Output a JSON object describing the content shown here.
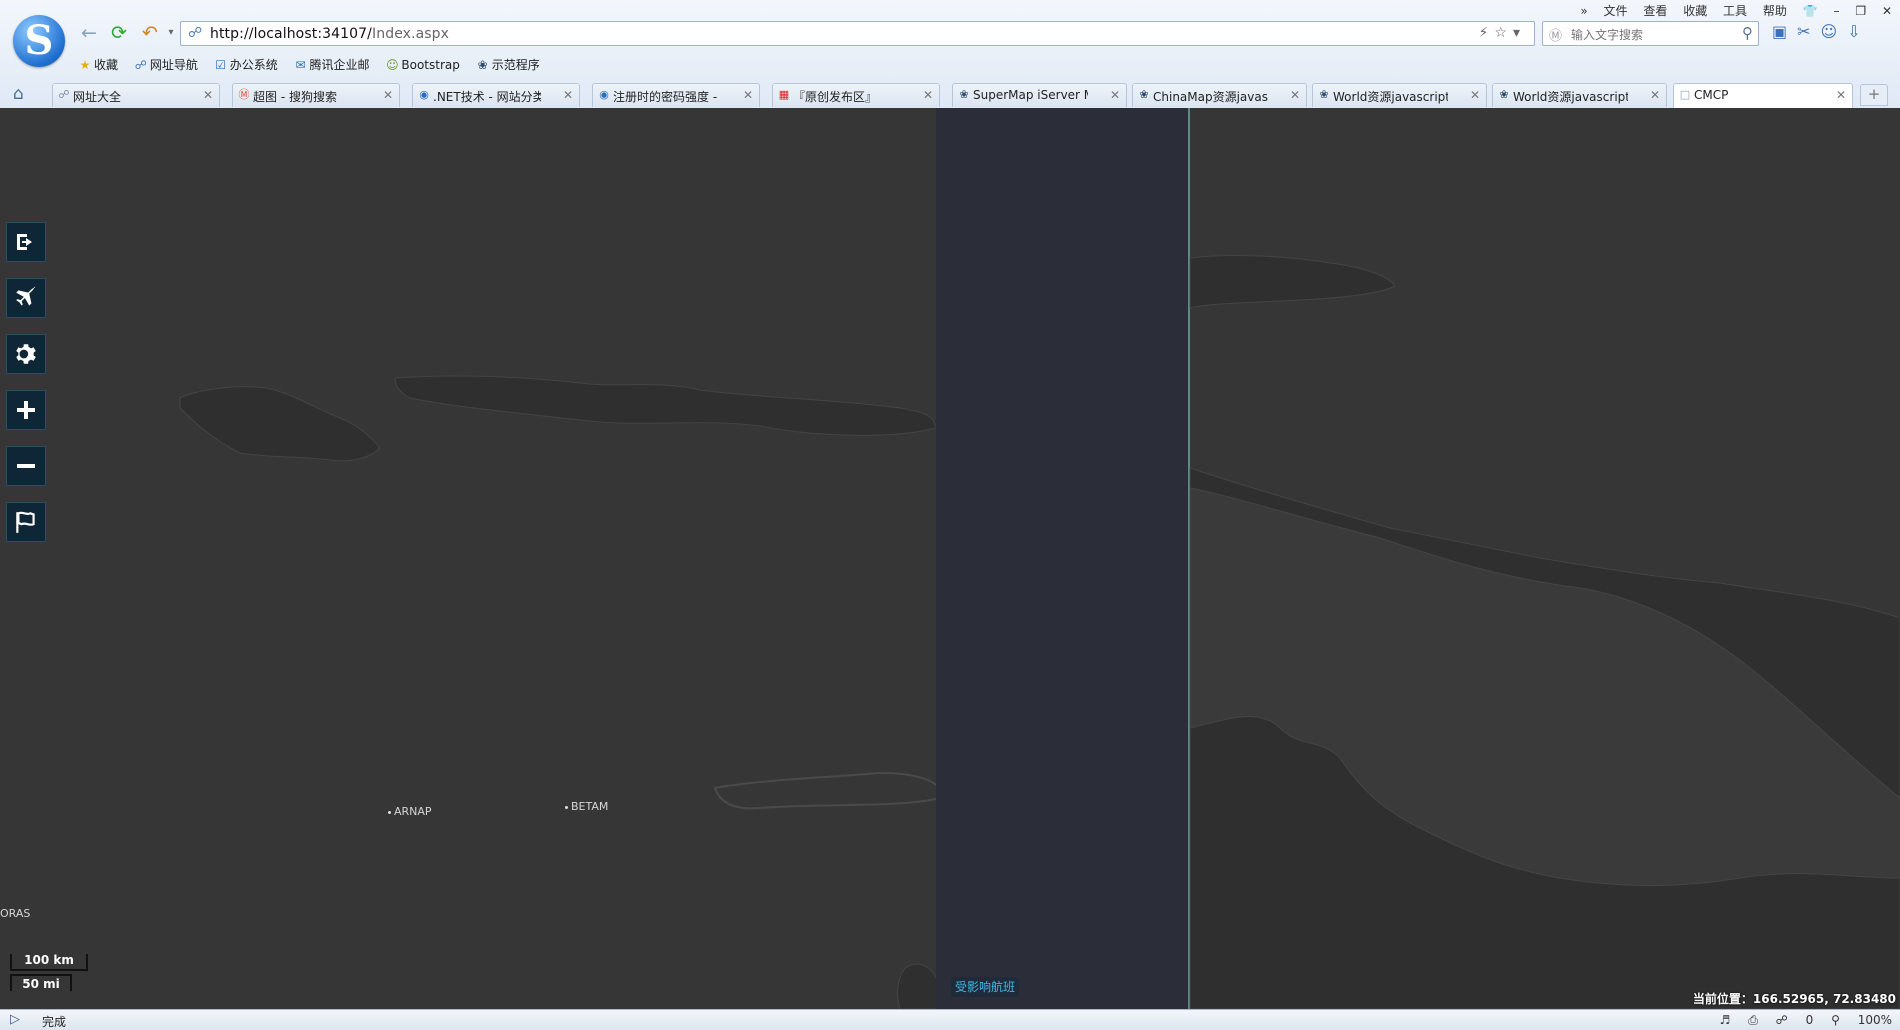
{
  "browser": {
    "url_host": "http://localhost:34107/",
    "url_path": "Index.aspx",
    "search_placeholder": "输入文字搜索",
    "menu": [
      "文件",
      "查看",
      "收藏",
      "工具",
      "帮助"
    ],
    "bookmarks": [
      {
        "label": "收藏",
        "icon": "star-icon"
      },
      {
        "label": "网址导航",
        "icon": "globe-icon"
      },
      {
        "label": "办公系统",
        "icon": "check-icon"
      },
      {
        "label": "腾讯企业邮",
        "icon": "mail-icon"
      },
      {
        "label": "Bootstrap",
        "icon": "bootstrap-icon"
      },
      {
        "label": "示范程序",
        "icon": "supermap-icon"
      }
    ],
    "tabs": [
      {
        "label": "网址大全"
      },
      {
        "label": "超图 - 搜狗搜索"
      },
      {
        "label": ".NET技术 - 网站分类 -"
      },
      {
        "label": "注册时的密码强度 - gir"
      },
      {
        "label": "『原创发布区』"
      },
      {
        "label": "SuperMap iServer Ma"
      },
      {
        "label": "ChinaMap资源javascri"
      },
      {
        "label": "World资源javascript示"
      },
      {
        "label": "World资源javascript示"
      },
      {
        "label": "CMCP"
      }
    ],
    "status_text": "完成",
    "status_right": [
      "0",
      "100%"
    ]
  },
  "map": {
    "labels": [
      "ARNAP",
      "BETAM",
      "ORAS"
    ],
    "scale_km": "100 km",
    "scale_mi": "50 mi",
    "flight_button": "受影响航班",
    "coord_label": "当前位置：",
    "coord_value": "166.52965, 72.83480",
    "controls": [
      "exit-icon",
      "plane-icon",
      "gear-icon",
      "plus-icon",
      "minus-icon",
      "flag-icon"
    ],
    "colors": {
      "land": "#3a3a3a",
      "water": "#2f2f2f",
      "panel": "#2b2e38",
      "border_line": "#6aa9a2",
      "control_bg": "#0f2636",
      "flight_text": "#3fb8e0"
    }
  }
}
